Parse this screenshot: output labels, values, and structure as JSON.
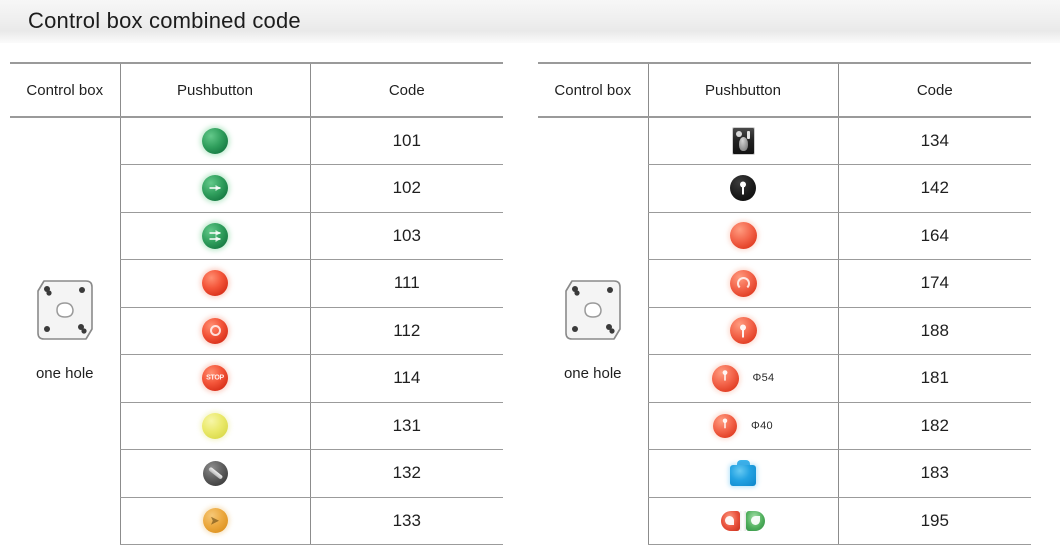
{
  "header": {
    "title": "Control box combined code",
    "band_color": "#efefef"
  },
  "tables": [
    {
      "id": "left",
      "columns": [
        "Control box",
        "Pushbutton",
        "Code"
      ],
      "control_box": {
        "caption": "one hole",
        "icon": "control-box-one-hole"
      },
      "rows": [
        {
          "icon": "pushbutton-green-plain",
          "dim": "",
          "code": "101"
        },
        {
          "icon": "pushbutton-green-arrow",
          "dim": "",
          "code": "102"
        },
        {
          "icon": "pushbutton-green-arrow-double",
          "dim": "",
          "code": "103"
        },
        {
          "icon": "pushbutton-red-plain",
          "dim": "",
          "code": "111"
        },
        {
          "icon": "pushbutton-red-ring",
          "dim": "",
          "code": "112"
        },
        {
          "icon": "pushbutton-red-stop",
          "dim": "",
          "code": "114"
        },
        {
          "icon": "pushbutton-yellow-plain",
          "dim": "",
          "code": "131"
        },
        {
          "icon": "selector-switch-dark-lever",
          "dim": "",
          "code": "132"
        },
        {
          "icon": "pushbutton-orange-symbol",
          "dim": "",
          "code": "133"
        }
      ]
    },
    {
      "id": "right",
      "columns": [
        "Control box",
        "Pushbutton",
        "Code"
      ],
      "control_box": {
        "caption": "one hole",
        "icon": "control-box-one-hole"
      },
      "rows": [
        {
          "icon": "selector-switch-square-black",
          "dim": "",
          "code": "134"
        },
        {
          "icon": "key-switch-black-round",
          "dim": "",
          "code": "142"
        },
        {
          "icon": "mushroom-red-plain",
          "dim": "",
          "code": "164"
        },
        {
          "icon": "mushroom-red-ring-open",
          "dim": "",
          "code": "174"
        },
        {
          "icon": "mushroom-red-key",
          "dim": "",
          "code": "188"
        },
        {
          "icon": "mushroom-red-key-small",
          "dim": "Φ54",
          "code": "181"
        },
        {
          "icon": "mushroom-red-key-small",
          "dim": "Φ40",
          "code": "182"
        },
        {
          "icon": "pushbutton-blue-square",
          "dim": "",
          "code": "183"
        },
        {
          "icon": "dual-pushbutton-red-green",
          "dim": "",
          "code": "195"
        }
      ]
    }
  ],
  "colors": {
    "green": "#2f9e5c",
    "red": "#e03c22",
    "yellow": "#eae96a",
    "orange": "#eca93f",
    "blue": "#23a2e2",
    "dark": "#2a2a2a",
    "border": "#9b9b9b",
    "text": "#1f1f1f"
  }
}
